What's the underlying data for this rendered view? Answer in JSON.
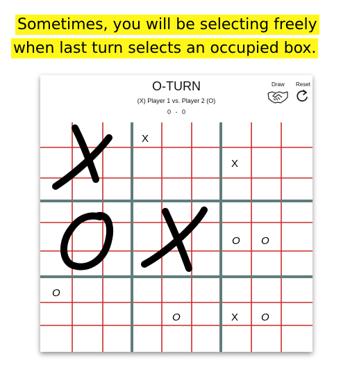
{
  "caption": {
    "line1": "Sometimes, you will be selecting freely",
    "line2": "when last turn selects an occupied box.",
    "highlight_color": "#fff71a"
  },
  "game": {
    "title": "O-TURN",
    "players": "(X) Player 1 vs. Player 2 (O)",
    "score": "0 - 0",
    "draw_label": "Draw",
    "reset_label": "Reset",
    "draw_icon": "handshake-icon",
    "reset_icon": "refresh-icon"
  },
  "board": {
    "colors": {
      "thin_lines": "#cc2a2a",
      "thick_lines": "#5f7d7d"
    },
    "big_marks": [
      {
        "board": "top-left",
        "mark": "X"
      },
      {
        "board": "middle-left",
        "mark": "O"
      },
      {
        "board": "middle-center",
        "mark": "X"
      }
    ],
    "small_marks": [
      {
        "board": "top-center",
        "cell": "top-left",
        "mark": "X"
      },
      {
        "board": "top-right",
        "cell": "middle-left",
        "mark": "X"
      },
      {
        "board": "middle-right",
        "cell": "middle-left",
        "mark": "O"
      },
      {
        "board": "middle-right",
        "cell": "middle-center",
        "mark": "O"
      },
      {
        "board": "bottom-left",
        "cell": "top-left",
        "mark": "O"
      },
      {
        "board": "bottom-center",
        "cell": "bottom-center",
        "mark": "O"
      },
      {
        "board": "bottom-right",
        "cell": "bottom-left",
        "mark": "X"
      },
      {
        "board": "bottom-right",
        "cell": "bottom-center",
        "mark": "O"
      }
    ]
  }
}
